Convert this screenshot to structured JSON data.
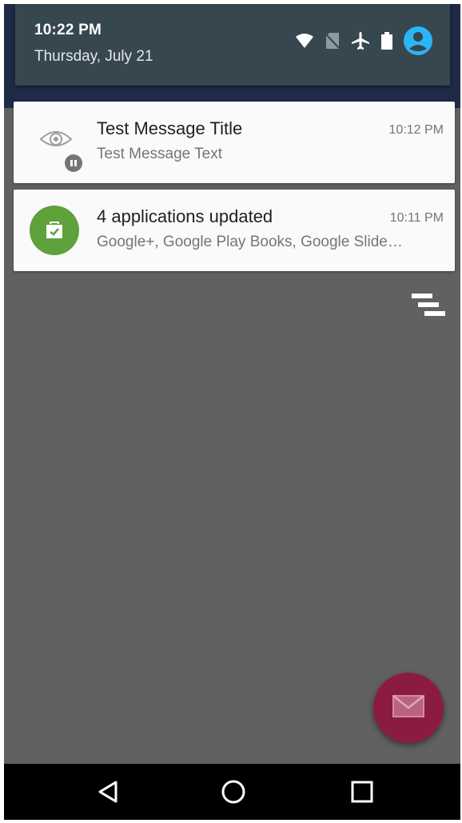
{
  "quick_settings": {
    "time": "10:22 PM",
    "date": "Thursday, July 21",
    "icons": [
      "wifi-icon",
      "no-sim-icon",
      "airplane-mode-icon",
      "battery-icon",
      "user-avatar-icon"
    ],
    "accent_color": "#29b6f6"
  },
  "notifications": [
    {
      "title": "Test Message Title",
      "text": "Test Message Text",
      "time": "10:12 PM",
      "icon": "eye-icon"
    },
    {
      "title": "4 applications updated",
      "text": "Google+, Google Play Books, Google Slide…",
      "time": "10:11 PM",
      "icon": "play-store-update-icon",
      "icon_color": "#5fa13a"
    }
  ],
  "clear_all": {
    "icon": "clear-all-icon"
  },
  "fab": {
    "icon": "mail-icon",
    "color": "#8b1b42"
  },
  "navigation": {
    "buttons": [
      "back-icon",
      "home-icon",
      "recents-icon"
    ]
  }
}
